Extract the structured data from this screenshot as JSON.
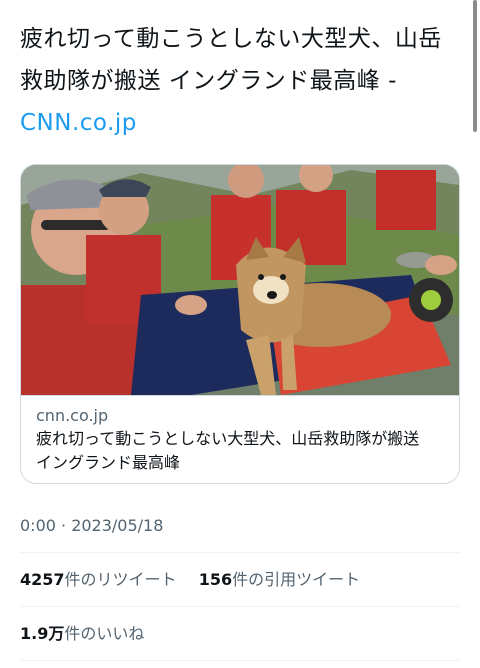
{
  "tweet": {
    "text": "疲れ切って動こうとしない大型犬、山岳救助隊が搬送 イングランド最高峰 - ",
    "link_text": "CNN.co.jp"
  },
  "card": {
    "domain": "cnn.co.jp",
    "title": "疲れ切って動こうとしない大型犬、山岳救助隊が搬送　イングランド最高峰",
    "image_icon": "rescue-dog-photo"
  },
  "meta": {
    "timestamp": "0:00 · 2023/05/18"
  },
  "stats": {
    "retweets_count": "4257",
    "retweets_label": "件のリツイート",
    "quotes_count": "156",
    "quotes_label": "件の引用ツイート",
    "likes_count": "1.9万",
    "likes_label": "件のいいね"
  },
  "colors": {
    "link": "#1d9bf0",
    "secondary_text": "#536471",
    "primary_text": "#0f1419",
    "border": "#cfd9de"
  }
}
